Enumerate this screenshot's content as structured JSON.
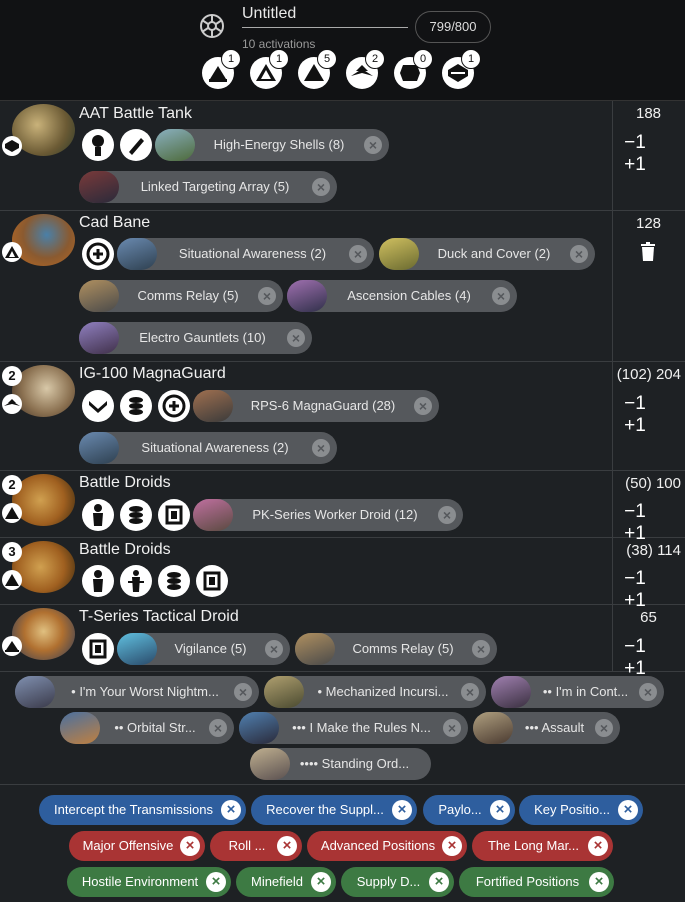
{
  "header": {
    "title": "Untitled",
    "activations": "10 activations",
    "points": "799/800",
    "ranks": [
      {
        "icon": "commander-rank-icon",
        "count": "1"
      },
      {
        "icon": "operative-rank-icon",
        "count": "1"
      },
      {
        "icon": "corps-rank-icon",
        "count": "5"
      },
      {
        "icon": "special-forces-rank-icon",
        "count": "2"
      },
      {
        "icon": "support-rank-icon",
        "count": "0"
      },
      {
        "icon": "heavy-rank-icon",
        "count": "1"
      }
    ]
  },
  "units": [
    {
      "name": "AAT Battle Tank",
      "points": "188",
      "rank_icon": "heavy-rank-icon",
      "upgrades": [
        {
          "label": "High-Energy Shells (8)"
        },
        {
          "label": "Linked Targeting Array (5)"
        }
      ]
    },
    {
      "name": "Cad Bane",
      "points": "128",
      "rank_icon": "operative-rank-icon",
      "upgrades": [
        {
          "label": "Situational Awareness (2)"
        },
        {
          "label": "Duck and Cover (2)"
        },
        {
          "label": "Comms Relay (5)"
        },
        {
          "label": "Ascension Cables (4)"
        },
        {
          "label": "Electro Gauntlets (10)"
        }
      ]
    },
    {
      "name": "IG-100 MagnaGuard",
      "points": "(102) 204",
      "count": "2",
      "rank_icon": "special-forces-rank-icon",
      "upgrades": [
        {
          "label": "RPS-6 MagnaGuard (28)"
        },
        {
          "label": "Situational Awareness (2)"
        }
      ]
    },
    {
      "name": "Battle Droids",
      "points": "(50) 100",
      "count": "2",
      "rank_icon": "corps-rank-icon",
      "upgrades": [
        {
          "label": "PK-Series Worker Droid (12)"
        }
      ]
    },
    {
      "name": "Battle Droids",
      "points": "(38) 114",
      "count": "3",
      "rank_icon": "corps-rank-icon",
      "upgrades": []
    },
    {
      "name": "T-Series Tactical Droid",
      "points": "65",
      "rank_icon": "commander-rank-icon",
      "upgrades": [
        {
          "label": "Vigilance (5)"
        },
        {
          "label": "Comms Relay (5)"
        }
      ]
    }
  ],
  "controls": {
    "minus": "−1",
    "plus": "+1"
  },
  "command_cards": [
    "• I'm Your Worst Nightm...",
    "• Mechanized Incursi...",
    "•• I'm in Cont...",
    "•• Orbital Str...",
    "••• I Make the Rules N...",
    "••• Assault",
    "•••• Standing Ord..."
  ],
  "objectives": {
    "blue": [
      "Intercept the Transmissions",
      "Recover the Suppl...",
      "Paylo...",
      "Key Positio..."
    ],
    "red": [
      "Major Offensive",
      "Roll ...",
      "Advanced Positions",
      "The Long Mar..."
    ],
    "green": [
      "Hostile Environment",
      "Minefield",
      "Supply D...",
      "Fortified Positions"
    ]
  },
  "colors": {
    "blue": "#2e5e9e",
    "red": "#a93434",
    "green": "#3d7a43",
    "pill": "#55585c",
    "background": "#1e2124"
  }
}
